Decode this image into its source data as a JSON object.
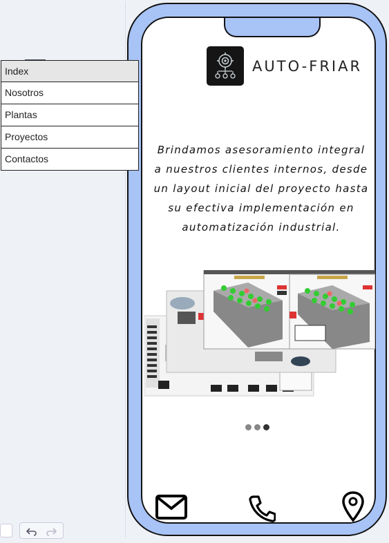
{
  "nav": {
    "items": [
      {
        "label": "Index"
      },
      {
        "label": "Nosotros"
      },
      {
        "label": "Plantas"
      },
      {
        "label": "Proyectos"
      },
      {
        "label": "Contactos"
      }
    ]
  },
  "header": {
    "brand": "AUTO-FRIAR",
    "menu_icon": "hamburger-icon",
    "logo_icon": "gear-circuit-logo"
  },
  "main": {
    "intro_text": "Brindamos asesoramiento integral a nuestros clientes internos, desde un layout inicial del proyecto hasta su efectiva implementación en automatización industrial."
  },
  "carousel": {
    "slide_count": 3,
    "active_index": 2
  },
  "footer": {
    "icons": [
      "mail-icon",
      "phone-icon",
      "location-pin-icon"
    ]
  },
  "colors": {
    "phone_frame": "#a8c3f5",
    "nav_active_bg": "#e6e6e6",
    "hamburger": "#3e4b5b"
  }
}
